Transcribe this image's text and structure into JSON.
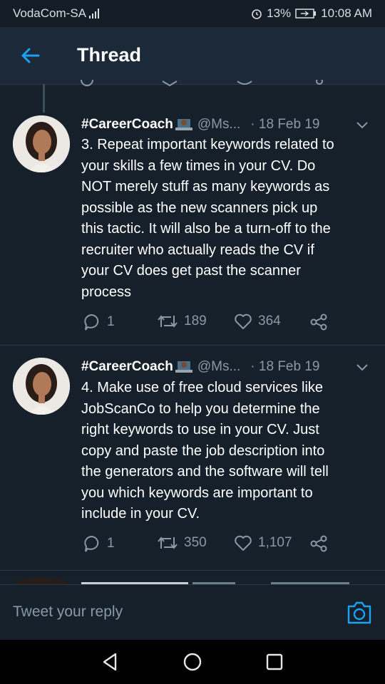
{
  "status_bar": {
    "carrier": "VodaCom-SA",
    "battery": "13%",
    "time": "10:08 AM"
  },
  "header": {
    "back_icon": "arrow-left-icon",
    "title": "Thread"
  },
  "tweets": [
    {
      "name": "#CareerCoach",
      "handle": "@Ms...",
      "date": "· 18 Feb 19",
      "text": "3. Repeat important keywords related to\nyour skills a few times in your CV. Do\nNOT merely stuff as many keywords as\npossible as the new scanners pick up\nthis tactic. It will also be a turn-off to the\nrecruiter who actually reads the CV if\nyour CV does get past the scanner\nprocess",
      "replies": "1",
      "retweets": "189",
      "likes": "364"
    },
    {
      "name": "#CareerCoach",
      "handle": "@Ms...",
      "date": "· 18 Feb 19",
      "text": "4. Make use of free cloud services like\nJobScanCo to help you determine the\nright keywords to use in your CV. Just\ncopy and paste the job description into\nthe generators and the software will tell\nyou which keywords are important to\ninclude in your CV.",
      "replies": "1",
      "retweets": "350",
      "likes": "1,107"
    }
  ],
  "reply_bar": {
    "placeholder": "Tweet your reply",
    "camera_icon": "camera-icon"
  },
  "nav_bar": {
    "back": "triangle-back-icon",
    "home": "circle-home-icon",
    "recents": "square-recents-icon"
  },
  "colors": {
    "background": "#15202b",
    "header": "#1c2938",
    "accent": "#1da1f2",
    "muted": "#8899a6"
  }
}
